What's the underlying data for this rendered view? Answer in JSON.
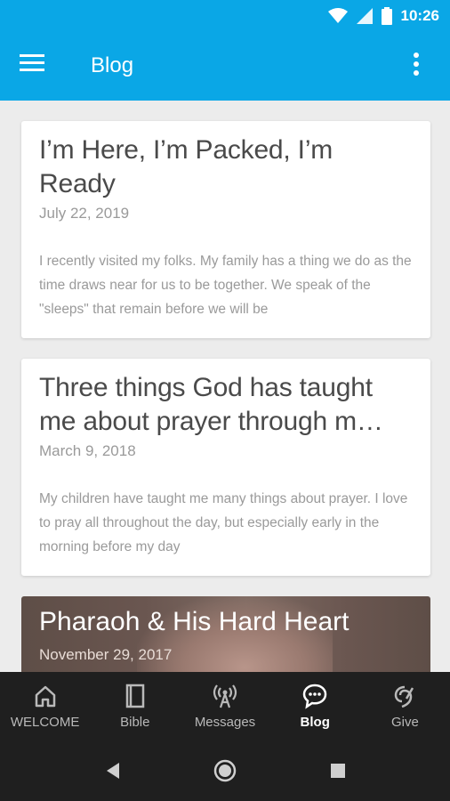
{
  "status_bar": {
    "time": "10:26",
    "icons": [
      "wifi-icon",
      "signal-icon",
      "battery-icon"
    ]
  },
  "app_bar": {
    "title": "Blog",
    "menu_icon": "hamburger-menu-icon",
    "overflow_icon": "more-vert-icon",
    "color": "#0aa7e6"
  },
  "posts": [
    {
      "title": "I’m Here, I’m Packed, I’m Ready",
      "date": "July 22, 2019",
      "excerpt": "I recently visited my folks.  My family has a thing we do as the time draws near for us to be together.  We speak of the \"sleeps\" that remain before we will be"
    },
    {
      "title": "Three things God has taught me about prayer through m…",
      "date": "March 9, 2018",
      "excerpt": "My children have taught me many things about prayer.  I love to pray all throughout the day, but especially early in the morning before my day"
    },
    {
      "title": "Pharaoh & His Hard Heart",
      "date": "November 29, 2017"
    }
  ],
  "bottom_nav": {
    "items": [
      {
        "label": "WELCOME",
        "icon": "home-icon",
        "active": false
      },
      {
        "label": "Bible",
        "icon": "book-icon",
        "active": false
      },
      {
        "label": "Messages",
        "icon": "broadcast-icon",
        "active": false
      },
      {
        "label": "Blog",
        "icon": "chat-bubble-icon",
        "active": true
      },
      {
        "label": "Give",
        "icon": "give-icon",
        "active": false
      }
    ]
  },
  "system_nav": {
    "icons": [
      "back-icon",
      "home-circle-icon",
      "recents-icon"
    ]
  }
}
